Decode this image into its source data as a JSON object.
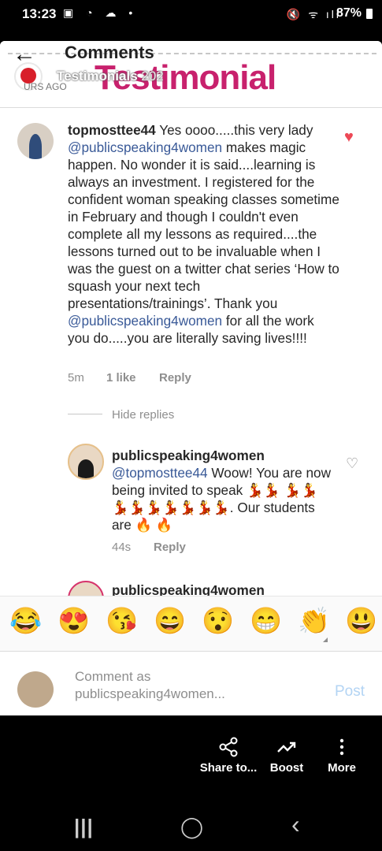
{
  "status_bar": {
    "time": "13:23",
    "left_icons": "▣ ◔ ☁ •",
    "right_icons": "🔇 ᯤ ıll",
    "battery": "87%"
  },
  "header": {
    "title": "Comments",
    "back_icon": "arrow-left-icon",
    "story_username_overlay": "Testimonials",
    "story_year_overlay": "202",
    "story_time_partial": "URS AGO",
    "post_image_text": "Testimonial"
  },
  "comments": {
    "main": {
      "username": "topmosttee44",
      "text_parts": [
        " Yes oooo.....this very lady ",
        "@publicspeaking4women",
        " makes magic happen. No wonder it is said....learning is always an investment. I registered for the confident woman speaking classes sometime in February and though I couldn't even complete all my lessons as required....the lessons turned out to be invaluable when I was the guest on a twitter chat series ‘How to squash your next tech presentations/trainings’. Thank you ",
        "@publicspeaking4women",
        " for all the work you do.....you are literally saving lives!!!!"
      ],
      "time": "5m",
      "likes": "1 like",
      "reply_label": "Reply",
      "liked": true
    },
    "hide_replies": "Hide replies",
    "reply": {
      "username": "publicspeaking4women",
      "mention": "@topmosttee44",
      "text": " Woow! You are now being invited to speak 💃💃 💃💃💃💃💃💃💃💃💃. Our students are 🔥 🔥",
      "time": "44s",
      "reply_label": "Reply"
    },
    "partial_reply_username": "publicspeaking4women"
  },
  "emoji_bar": [
    "😂",
    "😍",
    "😘",
    "😄",
    "😯",
    "😁",
    "👏",
    "😃"
  ],
  "comment_input": {
    "placeholder_line1": "Comment as",
    "placeholder_line2": "publicspeaking4women...",
    "post_label": "Post"
  },
  "actions": [
    {
      "icon": "share-icon",
      "glyph": "⋖",
      "label": "Share to..."
    },
    {
      "icon": "boost-icon",
      "glyph": "↗",
      "label": "Boost"
    },
    {
      "icon": "more-icon",
      "glyph": "⋮",
      "label": "More"
    }
  ],
  "nav": {
    "recents": "|||",
    "home": "◯",
    "back": "‹"
  },
  "colors": {
    "mention": "#3a5a98",
    "heart_liked": "#ed4956",
    "post_disabled": "#b3d4f4",
    "brand_pink": "#c8216d"
  }
}
